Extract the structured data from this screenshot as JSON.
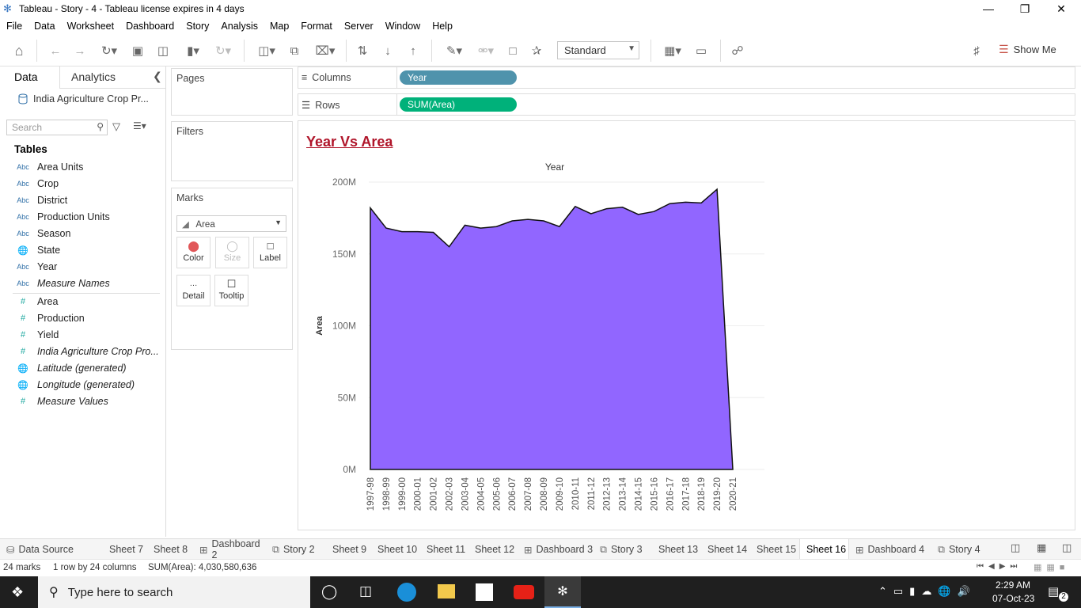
{
  "window": {
    "title": "Tableau - Story - 4 - Tableau license expires in 4 days"
  },
  "menu": [
    "File",
    "Data",
    "Worksheet",
    "Dashboard",
    "Story",
    "Analysis",
    "Map",
    "Format",
    "Server",
    "Window",
    "Help"
  ],
  "toolbar": {
    "fit_mode": "Standard",
    "show_me": "Show Me"
  },
  "left_pane": {
    "tab_data": "Data",
    "tab_analytics": "Analytics",
    "data_source": "India Agriculture Crop Pr...",
    "search_placeholder": "Search",
    "tables_heading": "Tables",
    "dimensions": [
      {
        "type": "Abc",
        "name": "Area Units"
      },
      {
        "type": "Abc",
        "name": "Crop"
      },
      {
        "type": "Abc",
        "name": "District"
      },
      {
        "type": "Abc",
        "name": "Production Units"
      },
      {
        "type": "Abc",
        "name": "Season"
      },
      {
        "type": "geo",
        "name": "State"
      },
      {
        "type": "Abc",
        "name": "Year"
      },
      {
        "type": "Abc",
        "name": "Measure Names"
      }
    ],
    "measures": [
      {
        "type": "#",
        "name": "Area"
      },
      {
        "type": "#",
        "name": "Production"
      },
      {
        "type": "#",
        "name": "Yield"
      },
      {
        "type": "#",
        "name": "India Agriculture Crop Pro..."
      },
      {
        "type": "geo",
        "name": "Latitude (generated)"
      },
      {
        "type": "geo",
        "name": "Longitude (generated)"
      },
      {
        "type": "#",
        "name": "Measure Values"
      }
    ]
  },
  "cards": {
    "pages": "Pages",
    "filters": "Filters",
    "marks": "Marks",
    "mark_type": "Area",
    "buttons": [
      "Color",
      "Size",
      "Label",
      "Detail",
      "Tooltip"
    ]
  },
  "shelves": {
    "columns_label": "Columns",
    "columns_pill": "Year",
    "rows_label": "Rows",
    "rows_pill": "SUM(Area)"
  },
  "chart_data": {
    "type": "area",
    "title": "Year Vs Area",
    "xlabel": "Year",
    "ylabel": "Area",
    "ylim": [
      0,
      200000000
    ],
    "y_ticks": [
      "0M",
      "50M",
      "100M",
      "150M",
      "200M"
    ],
    "x": [
      "1997-98",
      "1998-99",
      "1999-00",
      "2000-01",
      "2001-02",
      "2002-03",
      "2003-04",
      "2004-05",
      "2005-06",
      "2006-07",
      "2007-08",
      "2008-09",
      "2009-10",
      "2010-11",
      "2011-12",
      "2012-13",
      "2013-14",
      "2014-15",
      "2015-16",
      "2016-17",
      "2017-18",
      "2018-19",
      "2019-20",
      "2020-21"
    ],
    "values": [
      182000000,
      168000000,
      165500000,
      165500000,
      165000000,
      155000000,
      170000000,
      168000000,
      169000000,
      173000000,
      174000000,
      173000000,
      169000000,
      183000000,
      178000000,
      181500000,
      182500000,
      177500000,
      179500000,
      185000000,
      186000000,
      185500000,
      195000000,
      0
    ],
    "color": "#9166ff",
    "grid": true
  },
  "bottom_tabs": [
    {
      "label": "Data Source",
      "kind": "ds"
    },
    {
      "label": "Sheet 7",
      "kind": "sheet"
    },
    {
      "label": "Sheet 8",
      "kind": "sheet"
    },
    {
      "label": "Dashboard 2",
      "kind": "dash"
    },
    {
      "label": "Story 2",
      "kind": "story"
    },
    {
      "label": "Sheet 9",
      "kind": "sheet"
    },
    {
      "label": "Sheet 10",
      "kind": "sheet"
    },
    {
      "label": "Sheet 11",
      "kind": "sheet"
    },
    {
      "label": "Sheet 12",
      "kind": "sheet"
    },
    {
      "label": "Dashboard 3",
      "kind": "dash"
    },
    {
      "label": "Story 3",
      "kind": "story"
    },
    {
      "label": "Sheet 13",
      "kind": "sheet"
    },
    {
      "label": "Sheet 14",
      "kind": "sheet"
    },
    {
      "label": "Sheet 15",
      "kind": "sheet"
    },
    {
      "label": "Sheet 16",
      "kind": "sheet",
      "active": true
    },
    {
      "label": "Dashboard 4",
      "kind": "dash"
    },
    {
      "label": "Story 4",
      "kind": "story"
    }
  ],
  "status": {
    "marks": "24 marks",
    "dims": "1 row by 24 columns",
    "sum": "SUM(Area): 4,030,580,636"
  },
  "taskbar": {
    "search_placeholder": "Type here to search",
    "time": "2:29 AM",
    "date": "07-Oct-23",
    "notif_count": "2"
  },
  "colors": {
    "columns_pill": "#4f93ac",
    "rows_pill": "#00b17a",
    "title_red": "#b0152a"
  }
}
